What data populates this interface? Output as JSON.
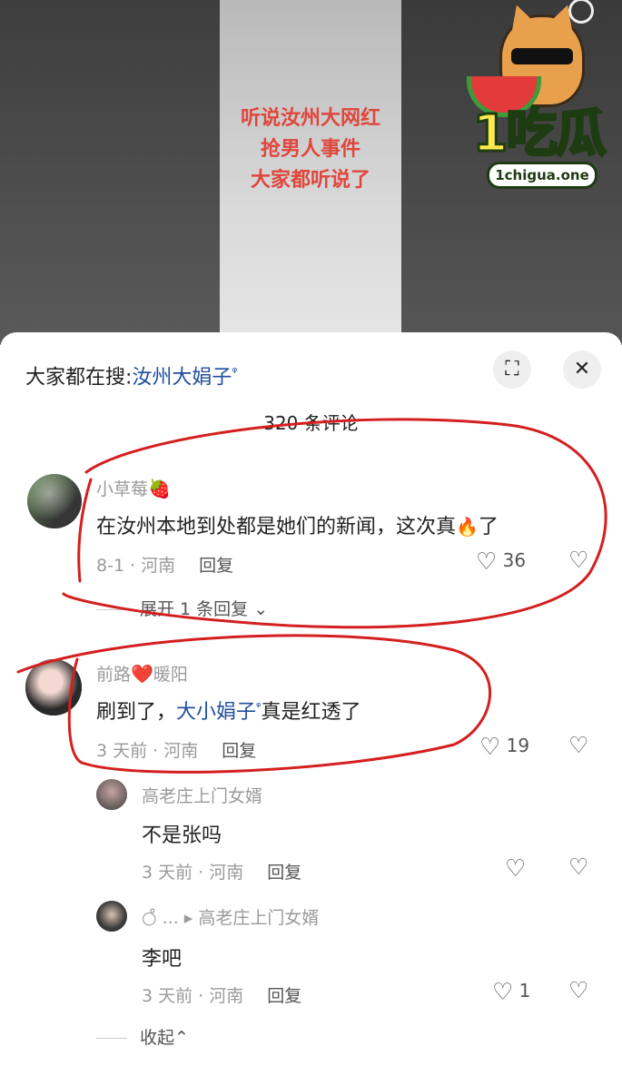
{
  "video": {
    "caption_lines": [
      "听说汝州大网红",
      "抢男人事件",
      "大家都听说了"
    ]
  },
  "brand": {
    "logo_text": "1吃瓜",
    "logo_url": "1chigua.one"
  },
  "search_bar": {
    "prefix": "大家都在搜:",
    "term": "汝州大娟子",
    "search_glyph": "ᵠ"
  },
  "header_buttons": {
    "expand_icon": "⛶",
    "close_icon": "✕"
  },
  "comment_count": "320 条评论",
  "comments": [
    {
      "user": "小草莓",
      "user_emoji": "🍓",
      "text_before": "在汝州本地到处都是她们的新闻，这次真",
      "text_emoji": "🔥",
      "text_after": "了",
      "time": "8-1 · 河南",
      "reply_label": "回复",
      "likes": "36",
      "expand_replies": "展开 1 条回复"
    },
    {
      "user_prefix": "前路",
      "user_emoji": "❤️",
      "user_suffix": "暖阳",
      "text_before": "刷到了，",
      "text_link": "大小娟子",
      "text_after": "真是红透了",
      "time": "3 天前 · 河南",
      "reply_label": "回复",
      "likes": "19"
    }
  ],
  "replies": [
    {
      "user": "高老庄上门女婿",
      "text": "不是张吗",
      "time": "3 天前 · 河南",
      "reply_label": "回复",
      "likes": ""
    },
    {
      "user": "○̊ ...",
      "reply_to_arrow": "▸",
      "reply_to": "高老庄上门女婿",
      "text": "李吧",
      "time": "3 天前 · 河南",
      "reply_label": "回复",
      "likes": "1"
    }
  ],
  "collapse_label": "收起",
  "collapse_icon": "⌃",
  "colors": {
    "link_blue": "#1f4e9c",
    "annotation_red": "#d41f1f",
    "caption_red": "#e0463c"
  }
}
